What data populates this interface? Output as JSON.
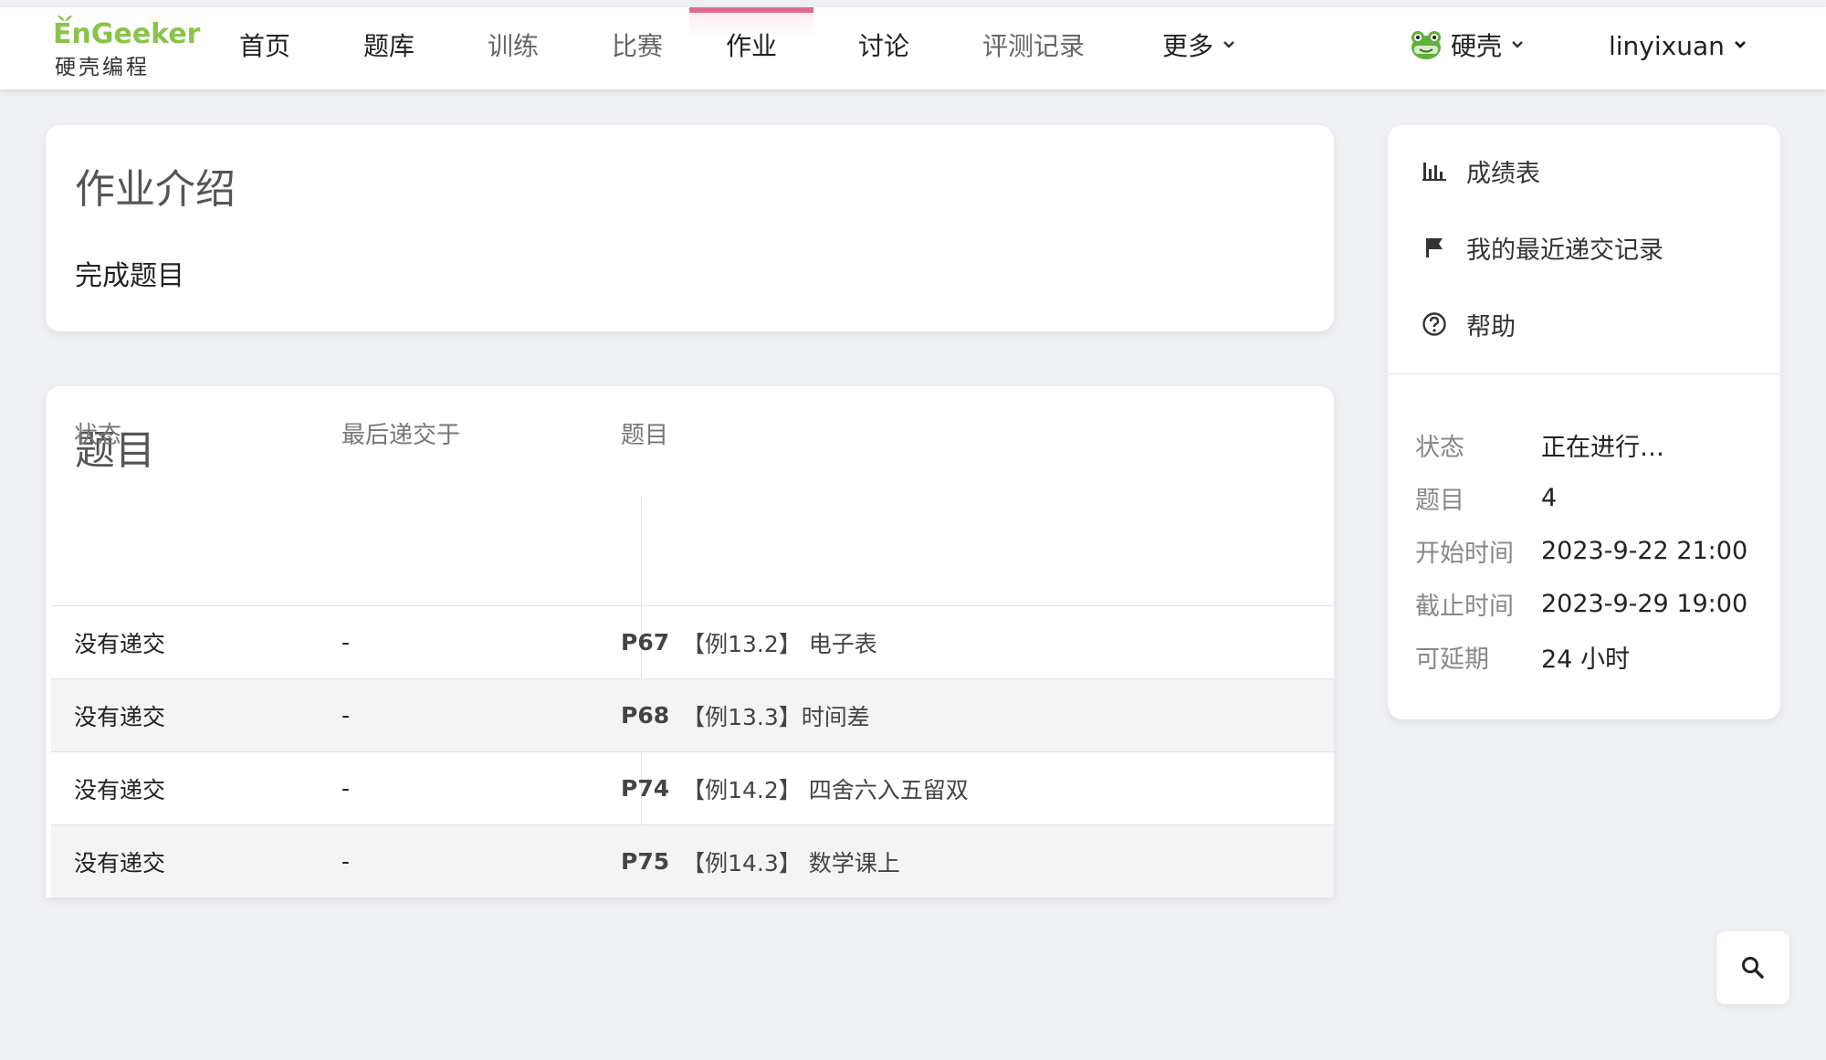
{
  "brand": {
    "logo_top": "EnGeeker",
    "logo_bottom": "硬壳编程",
    "color": "#8bc34a"
  },
  "nav": {
    "items": [
      {
        "label": "首页"
      },
      {
        "label": "题库"
      },
      {
        "label": "训练"
      },
      {
        "label": "比赛"
      },
      {
        "label": "作业"
      },
      {
        "label": "讨论"
      },
      {
        "label": "评测记录"
      },
      {
        "label": "更多"
      }
    ],
    "active_index": 4,
    "active_color": "#e06c8a"
  },
  "header_right": {
    "org_label": "硬壳",
    "username": "linyixuan"
  },
  "intro_card": {
    "title": "作业介绍",
    "text": "完成题目"
  },
  "problems_card": {
    "title": "题目",
    "columns": [
      "状态",
      "最后递交于",
      "题目"
    ],
    "rows": [
      {
        "status": "没有递交",
        "last": "-",
        "pid": "P67",
        "title": "【例13.2】 电子表"
      },
      {
        "status": "没有递交",
        "last": "-",
        "pid": "P68",
        "title": "【例13.3】时间差"
      },
      {
        "status": "没有递交",
        "last": "-",
        "pid": "P74",
        "title": "【例14.2】 四舍六入五留双"
      },
      {
        "status": "没有递交",
        "last": "-",
        "pid": "P75",
        "title": "【例14.3】 数学课上"
      }
    ]
  },
  "sidebar": {
    "links": [
      {
        "label": "成绩表",
        "icon": "bar-chart-icon"
      },
      {
        "label": "我的最近递交记录",
        "icon": "flag-icon"
      },
      {
        "label": "帮助",
        "icon": "help-circle-icon"
      }
    ],
    "info": [
      {
        "label": "状态",
        "value": "正在进行…"
      },
      {
        "label": "题目",
        "value": "4"
      },
      {
        "label": "开始时间",
        "value": "2023-9-22 21:00"
      },
      {
        "label": "截止时间",
        "value": "2023-9-29 19:00"
      },
      {
        "label": "可延期",
        "value": "24 小时"
      }
    ]
  },
  "fab": {
    "icon": "search-icon"
  }
}
